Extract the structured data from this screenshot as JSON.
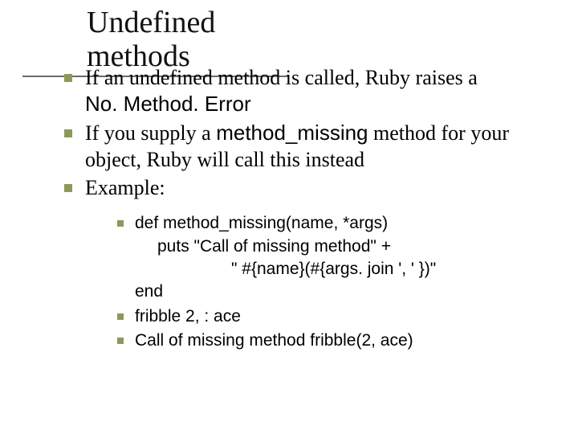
{
  "title": "Undefined methods",
  "bullets": {
    "b1a": "If an undefined method is called, Ruby raises a ",
    "b1b": "No. Method. Error",
    "b2a": "If you supply a ",
    "b2b": "method_missing",
    "b2c": " method for your object, Ruby will call this instead",
    "b3": "Example:"
  },
  "sub": {
    "s1l1": "def method_missing(name, *args)",
    "s1l2": "puts \"Call of missing method\" +",
    "s1l3": "\" #{name}(#{args. join ', ' })\"",
    "s1l4": "end",
    "s2": "fribble 2, : ace",
    "s3": "Call of missing method fribble(2, ace)"
  }
}
